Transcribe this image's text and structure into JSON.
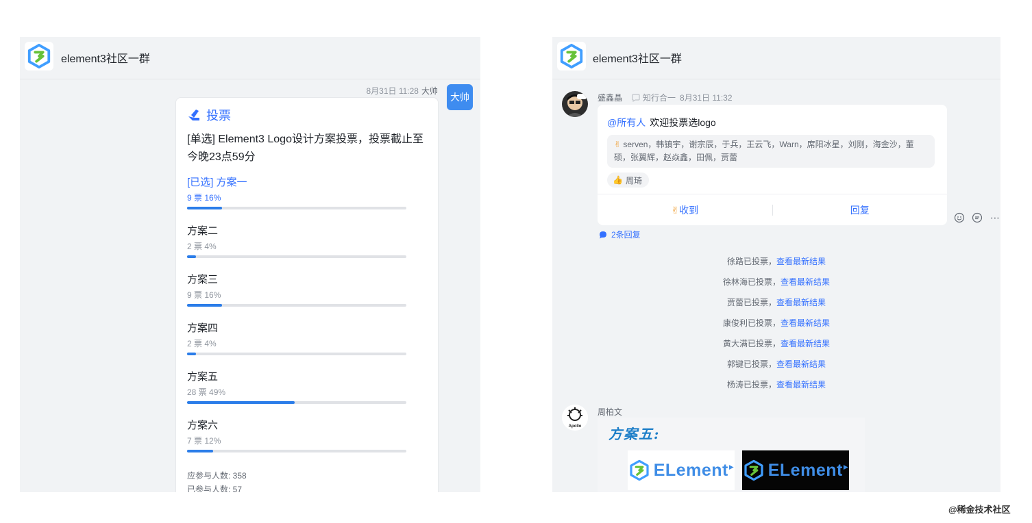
{
  "left": {
    "group_title": "element3社区一群",
    "sender_time": "8月31日 11:28",
    "sender_name": "大帅",
    "avatar_text": "大帅",
    "vote": {
      "heading": "投票",
      "question": "[单选] Element3 Logo设计方案投票，投票截止至今晚23点59分",
      "options": [
        {
          "name": "[已选] 方案一",
          "stat": "9 票  16%",
          "percent": 16,
          "selected": true
        },
        {
          "name": "方案二",
          "stat": "2 票  4%",
          "percent": 4,
          "selected": false
        },
        {
          "name": "方案三",
          "stat": "9 票  16%",
          "percent": 16,
          "selected": false
        },
        {
          "name": "方案四",
          "stat": "2 票  4%",
          "percent": 4,
          "selected": false
        },
        {
          "name": "方案五",
          "stat": "28 票  49%",
          "percent": 49,
          "selected": false
        },
        {
          "name": "方案六",
          "stat": "7 票  12%",
          "percent": 12,
          "selected": false
        }
      ],
      "expected": "应参与人数: 358",
      "participated": "已参与人数: 57"
    }
  },
  "right": {
    "group_title": "element3社区一群",
    "msg": {
      "sender": "盛鑫晶",
      "subtitle": "知行合一",
      "time": "8月31日 11:32",
      "at_text": "@所有人",
      "body": "欢迎投票选logo",
      "react_names": "serven，韩镇宇，谢宗辰，于兵，王云飞，Warn，席阳冰星，刘刚，海金沙，董硕，张翼辉，赵焱鑫，田佩，贾蕾",
      "react_chip": "周琦",
      "btn_received": "收到",
      "btn_reply": "回复",
      "reply_count": "2条回复"
    },
    "sys": [
      {
        "name": "徐路已投票，",
        "link": "查看最新结果"
      },
      {
        "name": "徐林海已投票，",
        "link": "查看最新结果"
      },
      {
        "name": "贾蕾已投票，",
        "link": "查看最新结果"
      },
      {
        "name": "康俊利已投票，",
        "link": "查看最新结果"
      },
      {
        "name": "黄大满已投票，",
        "link": "查看最新结果"
      },
      {
        "name": "郭键已投票，",
        "link": "查看最新结果"
      },
      {
        "name": "杨涛已投票，",
        "link": "查看最新结果"
      }
    ],
    "img_msg": {
      "sender": "周柏文",
      "avatar_label": "Apollo",
      "image_title": "方案五:",
      "logo_text": "ELement"
    }
  },
  "watermark": "@稀金技术社区",
  "colors": {
    "accent": "#3370ff",
    "bar": "#2b7de9",
    "panel": "#f1f3f5"
  }
}
